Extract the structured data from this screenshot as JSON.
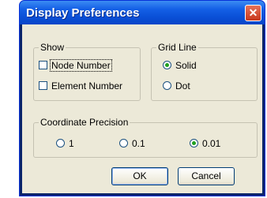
{
  "window": {
    "title": "Display Preferences",
    "close_glyph": "✕"
  },
  "show": {
    "legend": "Show",
    "node_number": "Node Number",
    "element_number": "Element Number"
  },
  "grid_line": {
    "legend": "Grid Line",
    "options": [
      "Solid",
      "Dot"
    ],
    "selected": "Solid"
  },
  "precision": {
    "legend": "Coordinate Precision",
    "options": [
      "1",
      "0.1",
      "0.01"
    ],
    "selected": "0.01"
  },
  "buttons": {
    "ok": "OK",
    "cancel": "Cancel"
  },
  "colors": {
    "titlebar": "#0a4fd6",
    "dialog_bg": "#ece9d8",
    "radio_dot": "#21a121"
  }
}
